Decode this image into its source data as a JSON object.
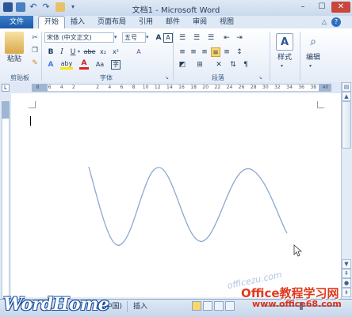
{
  "window": {
    "title": "文档1 - Microsoft Word"
  },
  "tabs": {
    "file": "文件",
    "items": [
      "开始",
      "插入",
      "页面布局",
      "引用",
      "邮件",
      "审阅",
      "视图"
    ]
  },
  "ribbon": {
    "clipboard": {
      "paste_label": "粘贴",
      "group_label": "剪贴板"
    },
    "font": {
      "font_name": "宋体 (中文正文)",
      "font_size": "五号",
      "font_size_icon_label": "wén",
      "bold": "B",
      "italic": "I",
      "underline": "U",
      "strikethrough": "abe",
      "subscript": "x₂",
      "superscript": "x²",
      "text_effects": "A",
      "highlight": "aby",
      "font_color": "A",
      "char_shading": "Aa",
      "grow_font": "A",
      "shrink_font": "A",
      "clear_format": "A",
      "phonetic": "A",
      "char_border": "A",
      "group_label": "字体"
    },
    "paragraph": {
      "group_label": "段落"
    },
    "styles": {
      "label": "样式"
    },
    "editing": {
      "label": "编辑"
    }
  },
  "ruler": {
    "marks": [
      "8",
      "6",
      "4",
      "2",
      "",
      "2",
      "4",
      "6",
      "8",
      "10",
      "12",
      "14",
      "16",
      "18",
      "20",
      "22",
      "24",
      "26",
      "28",
      "30",
      "32",
      "34",
      "36",
      "38",
      "40"
    ]
  },
  "statusbar": {
    "language": "文(中国)",
    "mode": "插入"
  },
  "watermarks": {
    "left": "WordHome",
    "site_name": "Office教程学习网",
    "site_url": "www.office68.com",
    "overlay": "officezu.com"
  },
  "colors": {
    "file_tab": "#1c5aa8",
    "curve": "#8aa9cf"
  }
}
